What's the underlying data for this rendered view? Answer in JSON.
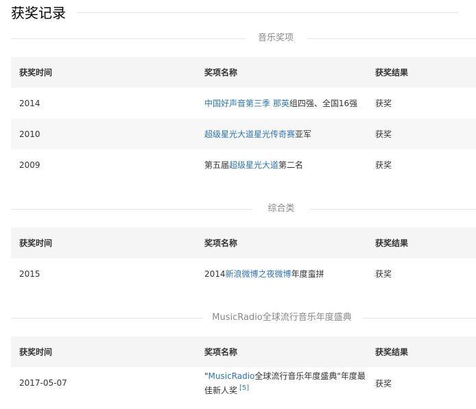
{
  "page_title": "获奖记录",
  "link_color": "#2e74b5",
  "columns": {
    "time": "获奖时间",
    "name": "奖项名称",
    "result": "获奖结果"
  },
  "sections": [
    {
      "title": "音乐奖项",
      "rows": [
        {
          "time": "2014",
          "name_link": "中国好声音第三季 那英",
          "name_suffix": "组四强、全国16强",
          "result": "获奖"
        },
        {
          "time": "2010",
          "name_link": "超级星光大道星光传奇赛",
          "name_suffix": "亚军",
          "result": "获奖"
        },
        {
          "time": "2009",
          "name_prefix": "第五届",
          "name_link": "超级星光大道",
          "name_suffix": "第二名",
          "result": "获奖"
        }
      ]
    },
    {
      "title": "综合类",
      "rows": [
        {
          "time": "2015",
          "name_prefix": "2014",
          "name_link": "新浪微博之夜微博",
          "name_suffix": "年度蛮拼",
          "result": "获奖"
        }
      ]
    },
    {
      "title": "MusicRadio全球流行音乐年度盛典",
      "rows": [
        {
          "time": "2017-05-07",
          "name_prefix": "\"",
          "name_link": "MusicRadio",
          "name_suffix": "全球流行音乐年度盛典\"年度最佳新人奖",
          "ref": "[5]",
          "result": "获奖"
        }
      ]
    }
  ]
}
